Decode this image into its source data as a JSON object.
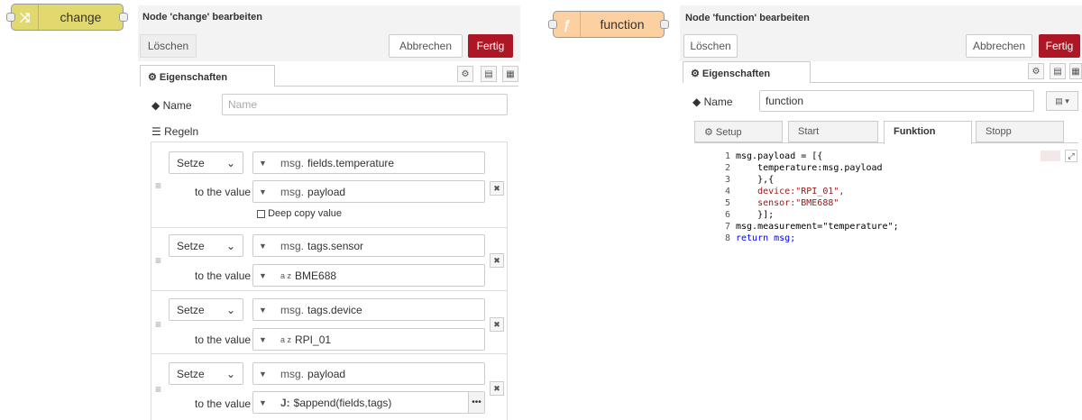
{
  "left_node": {
    "label": "change",
    "icon": "⤨"
  },
  "right_node": {
    "label": "function",
    "icon": "ƒ"
  },
  "change_panel": {
    "title": "Node 'change' bearbeiten",
    "delete_label": "Löschen",
    "cancel_label": "Abbrechen",
    "done_label": "Fertig",
    "tab_label": "⚙ Eigenschaften",
    "name_label": "Name",
    "name_placeholder": "Name",
    "rules_label": "Regeln",
    "to_the_value": "to the value",
    "deep_copy": "Deep copy value",
    "rules": [
      {
        "action": "Setze",
        "target_prefix": "msg.",
        "target": "fields.temperature",
        "value_prefix": "msg.",
        "value": "payload"
      },
      {
        "action": "Setze",
        "target_prefix": "msg.",
        "target": "tags.sensor",
        "value_prefix": "a z",
        "value": "BME688"
      },
      {
        "action": "Setze",
        "target_prefix": "msg.",
        "target": "tags.device",
        "value_prefix": "a z",
        "value": "RPI_01"
      },
      {
        "action": "Setze",
        "target_prefix": "msg.",
        "target": "payload",
        "value_prefix": "J:",
        "value": "$append(fields,tags)"
      }
    ]
  },
  "function_panel": {
    "title": "Node 'function' bearbeiten",
    "delete_label": "Löschen",
    "cancel_label": "Abbrechen",
    "done_label": "Fertig",
    "tab_label": "⚙ Eigenschaften",
    "name_label": "Name",
    "name_value": "function",
    "tabs": [
      "⚙ Setup",
      "Start",
      "Funktion",
      "Stopp"
    ],
    "code_lines": [
      "msg.payload = [{",
      "    temperature:msg.payload",
      "    },{",
      "    device:\"RPI_01\",",
      "    sensor:\"BME688\"",
      "    }];",
      "msg.measurement=\"temperature\";",
      "return msg;"
    ]
  },
  "colors": {
    "change_node": "#e2d96e",
    "function_node": "#fdd0a2",
    "primary": "#ad1625"
  }
}
